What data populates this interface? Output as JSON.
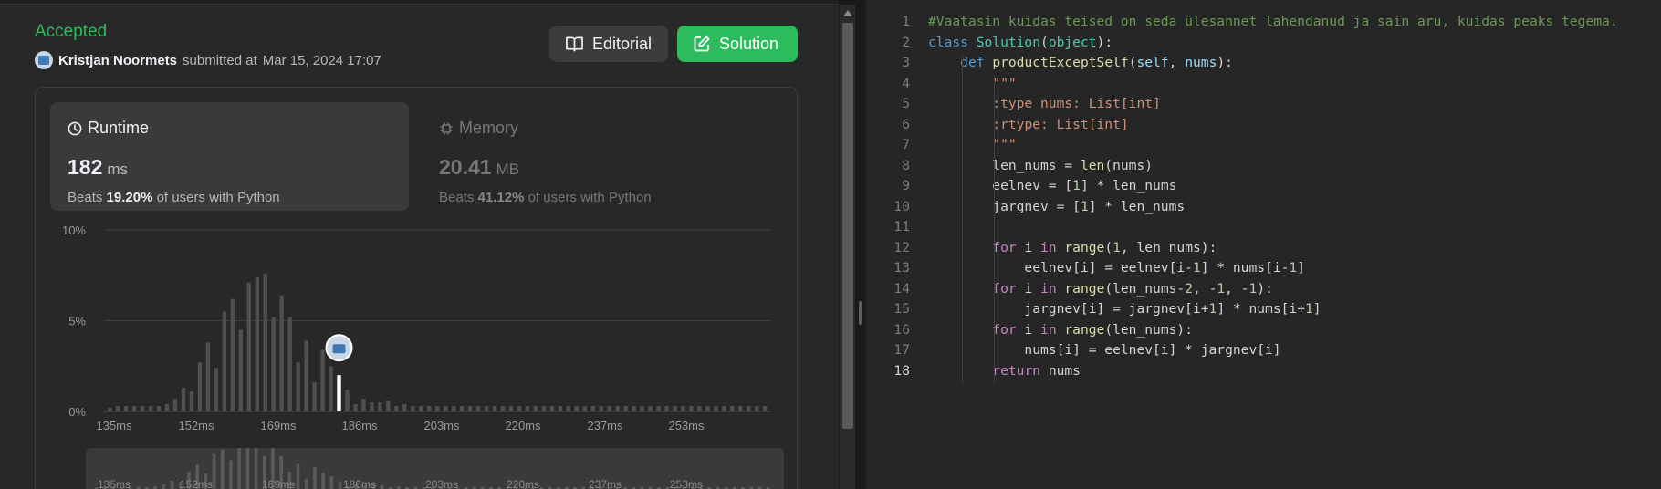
{
  "submission": {
    "status": "Accepted",
    "user": "Kristjan Noormets",
    "submitted_text": "submitted at",
    "date": "Mar 15, 2024 17:07",
    "editorial_label": "Editorial",
    "solution_label": "Solution"
  },
  "runtime": {
    "title": "Runtime",
    "value": "182",
    "unit": "ms",
    "beats_prefix": "Beats",
    "beats_percent": "19.20%",
    "beats_suffix": "of users with Python"
  },
  "memory": {
    "title": "Memory",
    "value": "20.41",
    "unit": "MB",
    "beats_prefix": "Beats",
    "beats_percent": "41.12%",
    "beats_suffix": "of users with Python"
  },
  "chart_data": {
    "type": "bar",
    "title": "",
    "xlabel": "",
    "ylabel": "",
    "y_ticks": [
      "10%",
      "5%",
      "0%"
    ],
    "x_ticks": [
      "135ms",
      "152ms",
      "169ms",
      "186ms",
      "203ms",
      "220ms",
      "237ms",
      "253ms"
    ],
    "ylim": [
      0,
      10
    ],
    "grid": true,
    "highlight_index": 28,
    "highlight_color": "#ffffff",
    "bar_color": "#4f4f4f",
    "values": [
      0.2,
      0.3,
      0.3,
      0.3,
      0.3,
      0.3,
      0.3,
      0.4,
      0.7,
      1.3,
      1.1,
      2.7,
      3.8,
      2.4,
      5.5,
      6.2,
      4.5,
      7.1,
      7.4,
      7.6,
      5.2,
      6.4,
      5.2,
      2.7,
      3.9,
      1.6,
      3.4,
      2.5,
      2.0,
      1.2,
      0.4,
      0.7,
      0.5,
      0.5,
      0.6,
      0.3,
      0.4,
      0.3,
      0.3,
      0.3,
      0.3,
      0.3,
      0.3,
      0.3,
      0.3,
      0.3,
      0.3,
      0.3,
      0.3,
      0.3,
      0.3,
      0.3,
      0.3,
      0.3,
      0.3,
      0.3,
      0.3,
      0.3,
      0.3,
      0.3,
      0.3,
      0.3,
      0.3,
      0.3,
      0.3,
      0.3,
      0.3,
      0.3,
      0.3,
      0.3,
      0.3,
      0.3,
      0.3,
      0.3,
      0.3,
      0.3,
      0.3,
      0.3,
      0.3,
      0.3,
      0.3
    ]
  },
  "mini_chart": {
    "x_ticks": [
      "135ms",
      "152ms",
      "169ms",
      "186ms",
      "203ms",
      "220ms",
      "237ms",
      "253ms"
    ]
  },
  "editor": {
    "active_line": 18,
    "lines": [
      [
        {
          "t": "#Vaatasin kuidas teised on seda ülesannet lahendanud ja sain aru, kuidas peaks tegema.",
          "c": "cmt"
        }
      ],
      [
        {
          "t": "class ",
          "c": "kw"
        },
        {
          "t": "Solution",
          "c": "cls"
        },
        {
          "t": "(",
          "c": ""
        },
        {
          "t": "object",
          "c": "cls"
        },
        {
          "t": "):",
          "c": ""
        }
      ],
      [
        {
          "t": "    "
        },
        {
          "t": "def ",
          "c": "kw"
        },
        {
          "t": "productExceptSelf",
          "c": "fn"
        },
        {
          "t": "(",
          "c": ""
        },
        {
          "t": "self",
          "c": "var"
        },
        {
          "t": ", ",
          "c": ""
        },
        {
          "t": "nums",
          "c": "var"
        },
        {
          "t": "):",
          "c": ""
        }
      ],
      [
        {
          "t": "        "
        },
        {
          "t": "\"\"\"",
          "c": "str"
        }
      ],
      [
        {
          "t": "        "
        },
        {
          "t": ":type nums: List[int]",
          "c": "str"
        }
      ],
      [
        {
          "t": "        "
        },
        {
          "t": ":rtype: List[int]",
          "c": "str"
        }
      ],
      [
        {
          "t": "        "
        },
        {
          "t": "\"\"\"",
          "c": "str"
        }
      ],
      [
        {
          "t": "        len_nums = "
        },
        {
          "t": "len",
          "c": "fn"
        },
        {
          "t": "(nums)"
        }
      ],
      [
        {
          "t": "        eelnev = ["
        },
        {
          "t": "1",
          "c": "num"
        },
        {
          "t": "] * len_nums"
        }
      ],
      [
        {
          "t": "        jargnev = ["
        },
        {
          "t": "1",
          "c": "num"
        },
        {
          "t": "] * len_nums"
        }
      ],
      [
        {
          "t": ""
        }
      ],
      [
        {
          "t": "        "
        },
        {
          "t": "for ",
          "c": "kw2"
        },
        {
          "t": "i "
        },
        {
          "t": "in ",
          "c": "kw2"
        },
        {
          "t": "range",
          "c": "fn"
        },
        {
          "t": "("
        },
        {
          "t": "1",
          "c": "num"
        },
        {
          "t": ", len_nums):"
        }
      ],
      [
        {
          "t": "            eelnev[i] = eelnev[i-"
        },
        {
          "t": "1",
          "c": "num"
        },
        {
          "t": "] * nums[i-"
        },
        {
          "t": "1",
          "c": "num"
        },
        {
          "t": "]"
        }
      ],
      [
        {
          "t": "        "
        },
        {
          "t": "for ",
          "c": "kw2"
        },
        {
          "t": "i "
        },
        {
          "t": "in ",
          "c": "kw2"
        },
        {
          "t": "range",
          "c": "fn"
        },
        {
          "t": "(len_nums-"
        },
        {
          "t": "2",
          "c": "num"
        },
        {
          "t": ", -"
        },
        {
          "t": "1",
          "c": "num"
        },
        {
          "t": ", -"
        },
        {
          "t": "1",
          "c": "num"
        },
        {
          "t": "):"
        }
      ],
      [
        {
          "t": "            jargnev[i] = jargnev[i+"
        },
        {
          "t": "1",
          "c": "num"
        },
        {
          "t": "] * nums[i+"
        },
        {
          "t": "1",
          "c": "num"
        },
        {
          "t": "]"
        }
      ],
      [
        {
          "t": "        "
        },
        {
          "t": "for ",
          "c": "kw2"
        },
        {
          "t": "i "
        },
        {
          "t": "in ",
          "c": "kw2"
        },
        {
          "t": "range",
          "c": "fn"
        },
        {
          "t": "(len_nums):"
        }
      ],
      [
        {
          "t": "            nums[i] = eelnev[i] * jargnev[i]"
        }
      ],
      [
        {
          "t": "        "
        },
        {
          "t": "return ",
          "c": "kw2"
        },
        {
          "t": "nums"
        }
      ]
    ]
  }
}
